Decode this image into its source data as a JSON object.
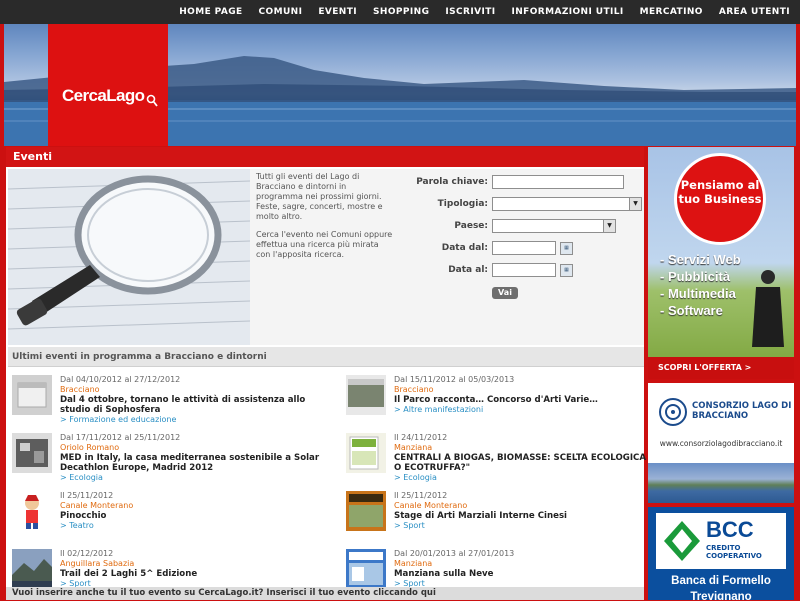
{
  "nav": {
    "items": [
      "HOME PAGE",
      "COMUNI",
      "EVENTI",
      "SHOPPING",
      "ISCRIVITI",
      "INFORMAZIONI UTILI",
      "MERCATINO",
      "AREA UTENTI"
    ]
  },
  "logo": {
    "text": "CercaLago"
  },
  "events_header": "Eventi",
  "intro": {
    "p1": "Tutti gli eventi del Lago di Bracciano e dintorni in programma nei prossimi giorni. Feste, sagre, concerti, mostre e molto altro.",
    "p2": "Cerca l'evento nei Comuni oppure effettua una ricerca più mirata con l'apposita ricerca."
  },
  "form": {
    "keyword_label": "Parola chiave:",
    "type_label": "Tipologia:",
    "town_label": "Paese:",
    "date_from_label": "Data dal:",
    "date_to_label": "Data al:",
    "submit_label": "Vai"
  },
  "list_header": "Ultimi eventi in programma a Bracciano e dintorni",
  "events": [
    {
      "date": "Dal 04/10/2012 al 27/12/2012",
      "location": "Bracciano",
      "title": "Dal 4 ottobre, tornano le attività di assistenza allo studio di Sophosfera",
      "category": "> Formazione ed educazione"
    },
    {
      "date": "Dal 15/11/2012 al 05/03/2013",
      "location": "Bracciano",
      "title": "Il Parco racconta… Concorso d'Arti Varie…",
      "category": "> Altre manifestazioni"
    },
    {
      "date": "Dal 17/11/2012 al 25/11/2012",
      "location": "Oriolo Romano",
      "title": "MED in Italy, la casa mediterranea sostenibile a Solar Decathlon Europe, Madrid 2012",
      "category": "> Ecologia"
    },
    {
      "date": "Il 24/11/2012",
      "location": "Manziana",
      "title": "CENTRALI A BIOGAS, BIOMASSE: SCELTA ECOLOGICA O ECOTRUFFA?\"",
      "category": "> Ecologia"
    },
    {
      "date": "Il 25/11/2012",
      "location": "Canale Monterano",
      "title": "Pinocchio",
      "category": "> Teatro"
    },
    {
      "date": "Il 25/11/2012",
      "location": "Canale Monterano",
      "title": "Stage di Arti Marziali Interne Cinesi",
      "category": "> Sport"
    },
    {
      "date": "Il 02/12/2012",
      "location": "Anguillara Sabazia",
      "title": "Trail dei 2 Laghi 5^ Edizione",
      "category": "> Sport"
    },
    {
      "date": "Dal 20/01/2013 al 27/01/2013",
      "location": "Manziana",
      "title": "Manziana sulla Neve",
      "category": "> Sport"
    }
  ],
  "footer_text": "Vuoi inserire anche tu il tuo evento su CercaLago.it? Inserisci il tuo evento cliccando qui",
  "ads": {
    "ad1": {
      "circle": "Pensiamo al tuo Business",
      "items": [
        "- Servizi Web",
        "- Pubblicità",
        "- Multimedia",
        "- Software"
      ],
      "cta": "SCOPRI L'OFFERTA >"
    },
    "ad2": {
      "name": "CONSORZIO LAGO DI BRACCIANO",
      "url": "www.consorziolagodibracciano.it"
    },
    "ad3": {
      "logo": "BCC",
      "subtitle": "CREDITO COOPERATIVO",
      "line1": "Banca di Formello",
      "line2": "Trevignano"
    }
  },
  "colors": {
    "brand_red": "#cc1010",
    "topbar": "#2a2a2a",
    "location_orange": "#e06b10",
    "category_blue": "#2a8fc4"
  }
}
